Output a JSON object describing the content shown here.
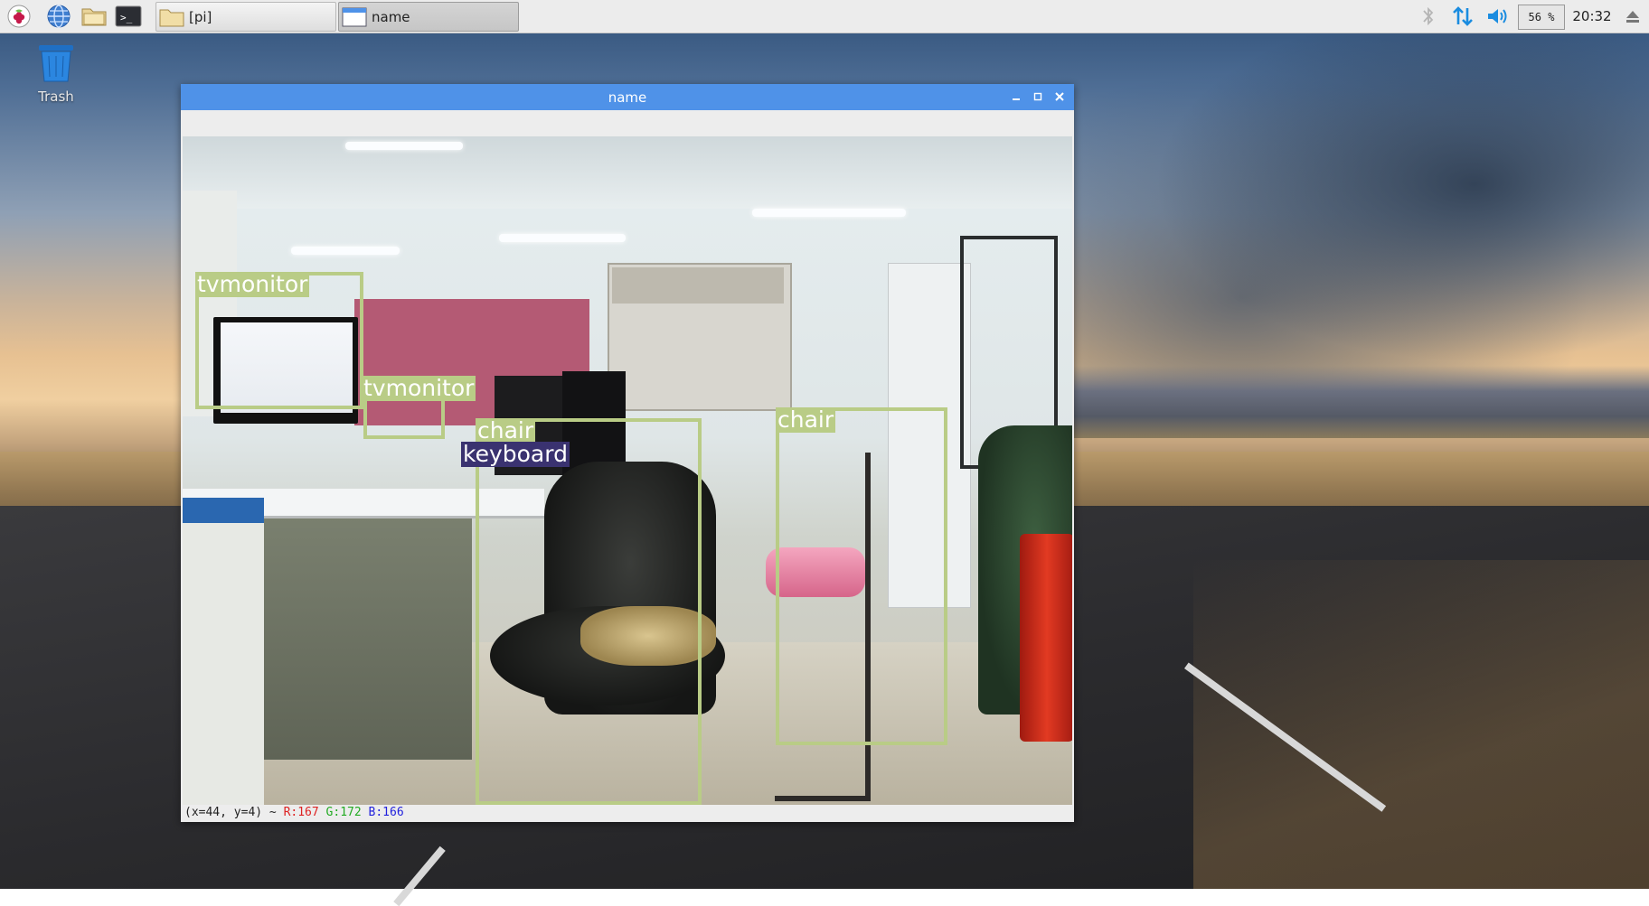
{
  "taskbar": {
    "task_buttons": [
      {
        "label": "[pi]"
      },
      {
        "label": "name"
      }
    ],
    "tray": {
      "cpu_label": "56 %",
      "clock": "20:32"
    }
  },
  "desktop": {
    "trash_label": "Trash"
  },
  "window": {
    "title": "name",
    "status": {
      "coords": "(x=44, y=4) ~",
      "r": "R:167",
      "g": "G:172",
      "b": "B:166"
    },
    "detections": [
      {
        "label": "tvmonitor"
      },
      {
        "label": "tvmonitor"
      },
      {
        "label": "chair"
      },
      {
        "label": "keyboard"
      },
      {
        "label": "chair"
      }
    ]
  },
  "colors": {
    "titlebar": "#4f92e8",
    "bbox": "#b9cc86",
    "keyboard_tag": "#3a3270"
  }
}
